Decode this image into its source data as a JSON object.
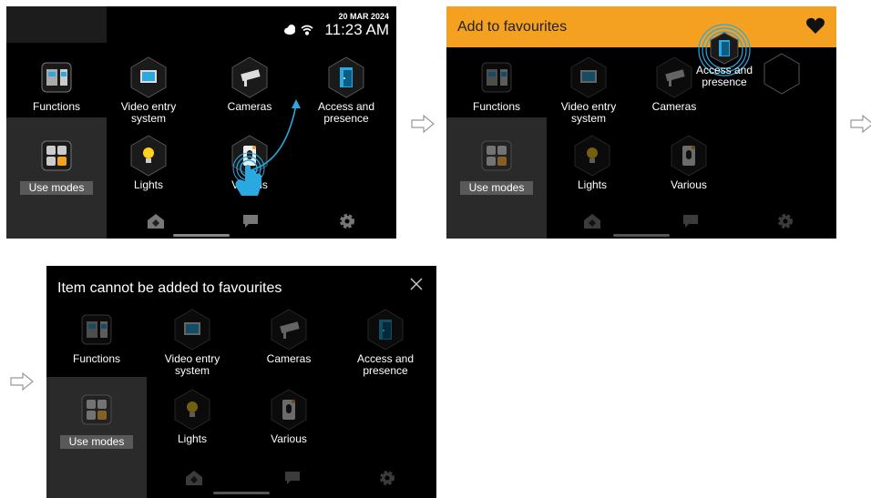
{
  "screen1": {
    "date": "20 MAR 2024",
    "time": "11:23 AM",
    "tiles": {
      "functions": "Functions",
      "video": "Video entry system",
      "cameras": "Cameras",
      "access": "Access and presence",
      "use_modes": "Use modes",
      "lights": "Lights",
      "various": "Various"
    }
  },
  "screen2": {
    "title": "Add to favourites",
    "tiles": {
      "functions": "Functions",
      "video": "Video entry system",
      "cameras": "Cameras",
      "access": "Access and presence",
      "use_modes": "Use modes",
      "lights": "Lights",
      "various": "Various"
    }
  },
  "screen3": {
    "title": "Item cannot be added to favourites",
    "tiles": {
      "functions": "Functions",
      "video": "Video entry system",
      "cameras": "Cameras",
      "access": "Access and presence",
      "use_modes": "Use modes",
      "lights": "Lights",
      "various": "Various"
    }
  },
  "colors": {
    "accent": "#f4a020",
    "screen_bg": "#000000",
    "tile_hex": "#1a1a1a",
    "blue": "#2aa8e0"
  },
  "icons": [
    "home-icon",
    "chat-icon",
    "gear-icon",
    "heart-icon",
    "close-icon",
    "cloud-icon",
    "wifi-icon",
    "tap-hand-icon",
    "next-arrow-icon"
  ]
}
